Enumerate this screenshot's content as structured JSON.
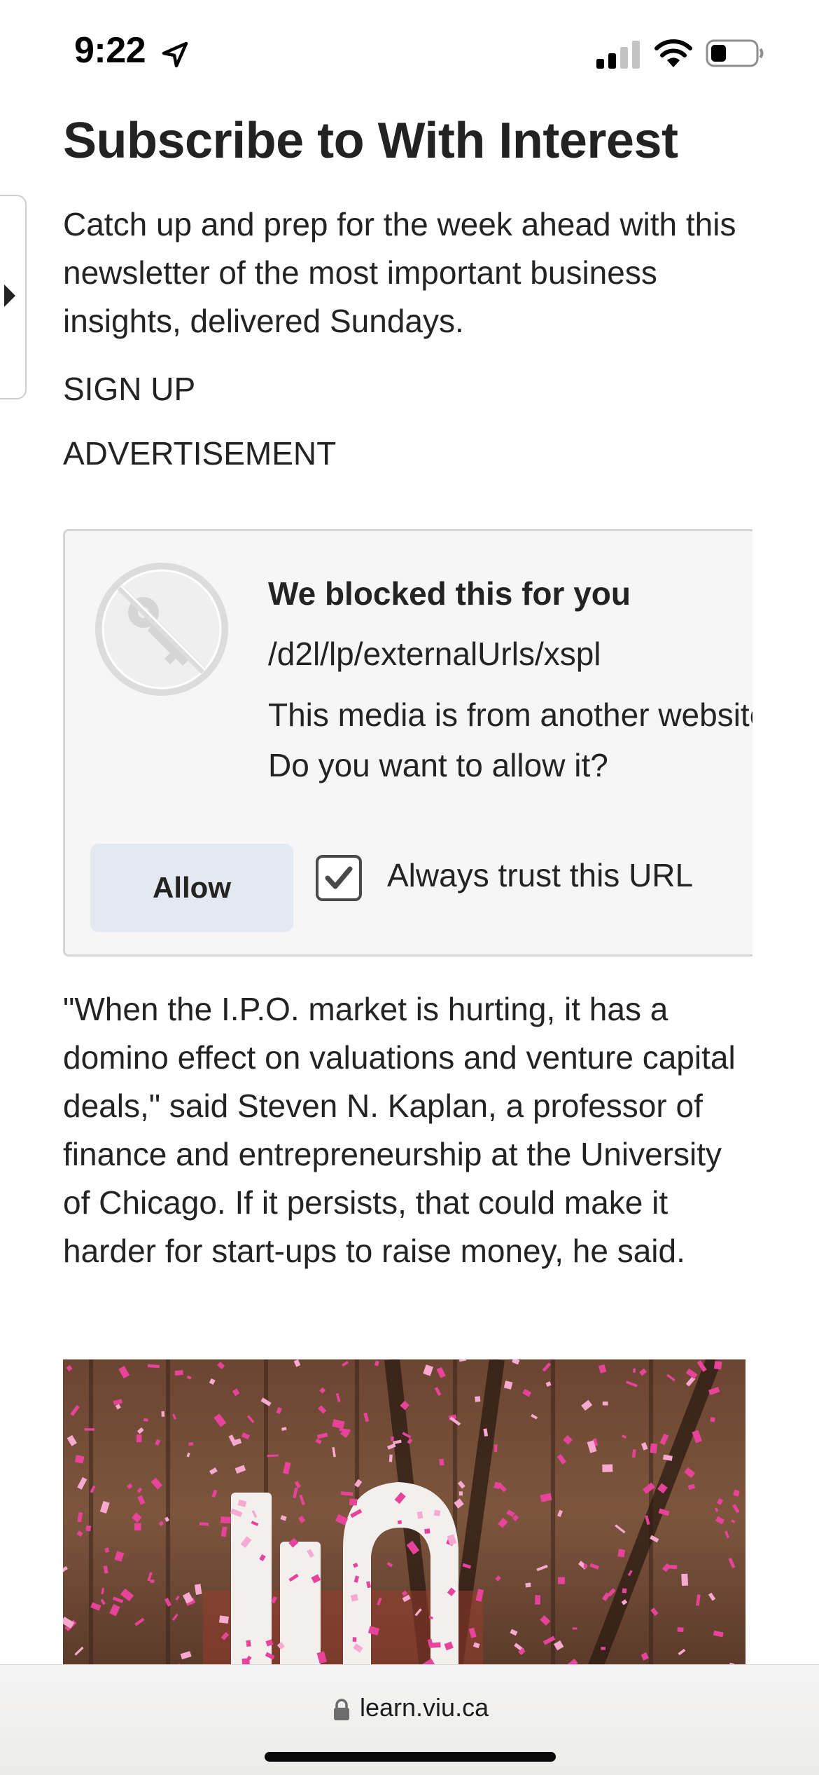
{
  "status_bar": {
    "time": "9:22",
    "location_icon": "location-arrow-icon",
    "signal_icon": "cellular-signal-icon",
    "wifi_icon": "wifi-icon",
    "battery_icon": "battery-icon",
    "signal_bars_active": 2,
    "signal_bars_total": 4,
    "battery_level": 0.35
  },
  "side_handle": {
    "icon": "chevron-right-icon"
  },
  "newsletter": {
    "title": "Subscribe to With Interest",
    "description": "Catch up and prep for the week ahead with this newsletter of the most important business insights, delivered Sundays.",
    "sign_up_label": "SIGN UP",
    "advertisement_label": "ADVERTISEMENT"
  },
  "blocked_media": {
    "icon": "blocked-key-icon",
    "title": "We blocked this for you",
    "url": "/d2l/lp/externalUrls/xspl",
    "message_line1": "This media is from another website.",
    "message_line2": "Do you want to allow it?",
    "allow_label": "Allow",
    "always_trust_label": "Always trust this URL",
    "always_trust_checked": true
  },
  "article": {
    "quote": "\"When the I.P.O. market is hurting, it has a domino effect on valuations and venture capital deals,\" said Steven N. Kaplan, a professor of finance and entrepreneurship at the University of Chicago. If it persists, that could make it harder for start-ups to raise money, he said."
  },
  "browser": {
    "lock_icon": "lock-icon",
    "url": "learn.viu.ca"
  },
  "colors": {
    "text": "#232323",
    "allow_button_bg": "#e4e8f0",
    "card_bg": "#f6f6f6",
    "card_border": "#d6d6d6",
    "confetti_pink": "#e8439a"
  }
}
